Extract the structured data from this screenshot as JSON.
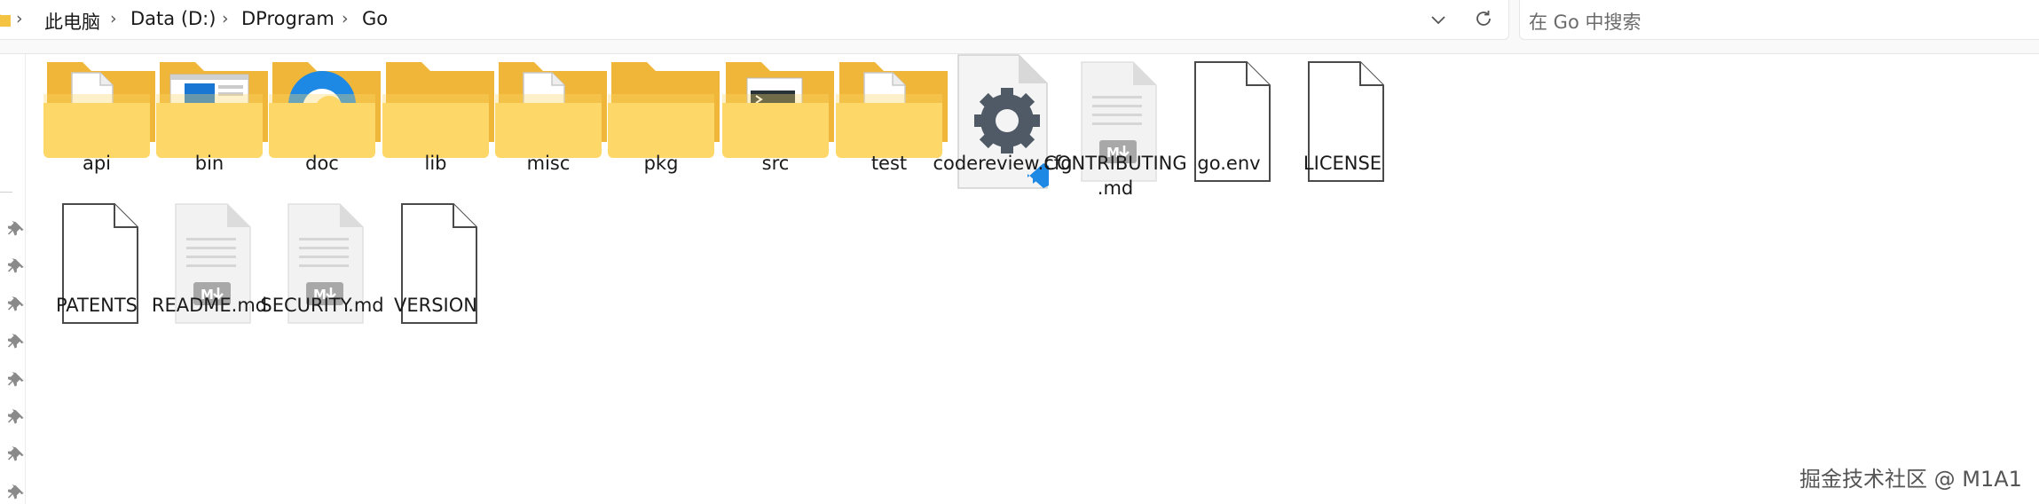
{
  "breadcrumb": {
    "items": [
      "此电脑",
      "Data (D:)",
      "DProgram",
      "Go"
    ],
    "separator": "›"
  },
  "search": {
    "placeholder": "在 Go 中搜索"
  },
  "files": [
    {
      "name": "api",
      "kind": "folder",
      "content_icon": "document-icon"
    },
    {
      "name": "bin",
      "kind": "folder",
      "content_icon": "window-icon"
    },
    {
      "name": "doc",
      "kind": "folder",
      "content_icon": "edge-browser-icon"
    },
    {
      "name": "lib",
      "kind": "folder",
      "content_icon": "none"
    },
    {
      "name": "misc",
      "kind": "folder",
      "content_icon": "document-icon"
    },
    {
      "name": "pkg",
      "kind": "folder",
      "content_icon": "none"
    },
    {
      "name": "src",
      "kind": "folder",
      "content_icon": "terminal-icon"
    },
    {
      "name": "test",
      "kind": "folder",
      "content_icon": "document-icon"
    },
    {
      "name": "codereview.cfg",
      "kind": "config-file",
      "icon": "vscode-gear-icon"
    },
    {
      "name": "CONTRIBUTING\n.md",
      "kind": "markdown-file",
      "icon": "markdown-icon"
    },
    {
      "name": "go.env",
      "kind": "blank-file",
      "icon": "file-icon"
    },
    {
      "name": "LICENSE",
      "kind": "blank-file",
      "icon": "file-icon"
    },
    {
      "name": "PATENTS",
      "kind": "blank-file",
      "icon": "file-icon"
    },
    {
      "name": "README.md",
      "kind": "markdown-file",
      "icon": "markdown-icon"
    },
    {
      "name": "SECURITY.md",
      "kind": "markdown-file",
      "icon": "markdown-icon"
    },
    {
      "name": "VERSION",
      "kind": "blank-file",
      "icon": "file-icon"
    }
  ],
  "watermark": "掘金技术社区 @ M1A1",
  "colors": {
    "folder_back": "#f0b63a",
    "folder_front": "#fdd767",
    "vscode_blue": "#1e88e5",
    "gear": "#4f5a66"
  }
}
